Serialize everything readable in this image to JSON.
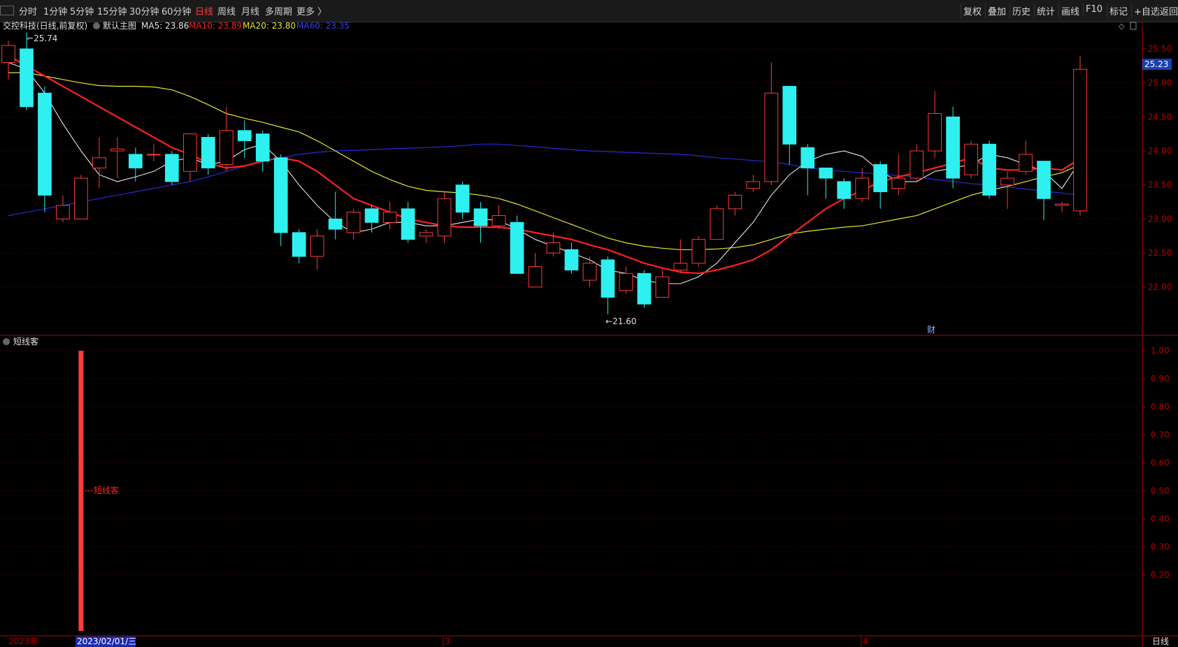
{
  "toolbar": {
    "periods": [
      "分时",
      "1分钟",
      "5分钟",
      "15分钟",
      "30分钟",
      "60分钟",
      "日线",
      "周线",
      "月线",
      "多周期",
      "更多 〉"
    ],
    "active_period": "日线",
    "right_buttons": [
      "复权",
      "叠加",
      "历史",
      "统计",
      "画线",
      "F10",
      "标记",
      "+自选",
      "返回"
    ]
  },
  "header": {
    "stock": "交控科技(日线,前复权)",
    "main_chart": "默认主图",
    "ma5": "MA5: 23.86",
    "ma10": "MA10: 23.89",
    "ma20": "MA20: 23.80",
    "ma60": "MA60: 23.35"
  },
  "colors": {
    "up": "#ff3b3b",
    "down": "#2ef0f0",
    "ma5": "#e8e8e8",
    "ma10": "#ff2020",
    "ma20": "#e6e62e",
    "ma60": "#2a2ad8",
    "axis": "#b40000"
  },
  "annotations": {
    "high": "25.74",
    "low": "21.60",
    "fin": "财"
  },
  "last_price": "25.23",
  "indicator": {
    "name": "短线客",
    "label": "短线客"
  },
  "xaxis": {
    "year": "2023年",
    "cursor_date": "2023/02/01/三",
    "m3": "3",
    "m4": "4",
    "period": "日线"
  },
  "chart_data": {
    "type": "candlestick",
    "price_axis": {
      "ticks": [
        "25.50",
        "25.00",
        "24.50",
        "24.00",
        "23.50",
        "23.00",
        "22.50",
        "22.00"
      ],
      "ylim": [
        21.3,
        25.9
      ]
    },
    "candles": [
      [
        25.3,
        25.55,
        25.62,
        25.05
      ],
      [
        25.5,
        24.65,
        25.74,
        24.6
      ],
      [
        24.85,
        23.35,
        24.95,
        23.1
      ],
      [
        23.0,
        23.2,
        23.35,
        22.95
      ],
      [
        23.0,
        23.6,
        23.65,
        23.0
      ],
      [
        23.75,
        23.9,
        24.2,
        23.45
      ],
      [
        24.0,
        24.03,
        24.2,
        23.6
      ],
      [
        23.95,
        23.75,
        24.05,
        23.55
      ],
      [
        23.95,
        23.95,
        24.1,
        23.85
      ],
      [
        23.95,
        23.55,
        24.0,
        23.5
      ],
      [
        23.7,
        24.25,
        24.25,
        23.55
      ],
      [
        24.2,
        23.75,
        24.25,
        23.65
      ],
      [
        23.8,
        24.3,
        24.65,
        23.7
      ],
      [
        24.3,
        24.15,
        24.45,
        23.9
      ],
      [
        24.25,
        23.85,
        24.3,
        23.7
      ],
      [
        23.9,
        22.8,
        23.95,
        22.6
      ],
      [
        22.8,
        22.45,
        22.85,
        22.35
      ],
      [
        22.45,
        22.75,
        22.85,
        22.25
      ],
      [
        23.0,
        22.85,
        23.4,
        22.7
      ],
      [
        22.8,
        23.1,
        23.15,
        22.7
      ],
      [
        23.15,
        22.95,
        23.2,
        22.8
      ],
      [
        22.95,
        23.1,
        23.25,
        22.85
      ],
      [
        23.15,
        22.7,
        23.25,
        22.65
      ],
      [
        22.75,
        22.8,
        22.85,
        22.65
      ],
      [
        22.75,
        23.3,
        23.4,
        22.65
      ],
      [
        23.5,
        23.1,
        23.55,
        23.0
      ],
      [
        23.15,
        22.9,
        23.25,
        22.65
      ],
      [
        22.9,
        23.05,
        23.2,
        22.85
      ],
      [
        22.95,
        22.2,
        23.05,
        22.2
      ],
      [
        22.0,
        22.3,
        22.5,
        22.0
      ],
      [
        22.5,
        22.65,
        22.8,
        22.45
      ],
      [
        22.55,
        22.25,
        22.65,
        22.2
      ],
      [
        22.1,
        22.35,
        22.45,
        22.0
      ],
      [
        22.4,
        21.85,
        22.45,
        21.6
      ],
      [
        21.95,
        22.2,
        22.3,
        21.9
      ],
      [
        22.2,
        21.75,
        22.25,
        21.7
      ],
      [
        21.85,
        22.15,
        22.25,
        21.85
      ],
      [
        22.25,
        22.35,
        22.7,
        22.2
      ],
      [
        22.35,
        22.7,
        22.75,
        22.3
      ],
      [
        22.7,
        23.15,
        23.2,
        22.7
      ],
      [
        23.15,
        23.35,
        23.4,
        23.05
      ],
      [
        23.45,
        23.55,
        23.65,
        23.4
      ],
      [
        23.55,
        24.85,
        25.3,
        23.5
      ],
      [
        24.95,
        24.1,
        24.95,
        23.8
      ],
      [
        24.05,
        23.75,
        24.1,
        23.35
      ],
      [
        23.75,
        23.6,
        23.75,
        23.3
      ],
      [
        23.55,
        23.3,
        23.6,
        23.15
      ],
      [
        23.3,
        23.6,
        23.75,
        23.25
      ],
      [
        23.8,
        23.4,
        23.85,
        23.15
      ],
      [
        23.45,
        23.6,
        23.95,
        23.35
      ],
      [
        23.6,
        24.0,
        24.1,
        23.55
      ],
      [
        24.0,
        24.55,
        24.88,
        23.9
      ],
      [
        24.5,
        23.6,
        24.65,
        23.45
      ],
      [
        23.65,
        24.1,
        24.15,
        23.6
      ],
      [
        24.1,
        23.35,
        24.15,
        23.3
      ],
      [
        23.5,
        23.6,
        23.7,
        23.15
      ],
      [
        23.7,
        23.95,
        24.15,
        23.65
      ],
      [
        23.85,
        23.3,
        23.85,
        22.98
      ],
      [
        23.2,
        23.22,
        23.25,
        23.1
      ],
      [
        23.12,
        25.2,
        25.4,
        23.05
      ]
    ],
    "ma5": [
      25.3,
      25.2,
      24.85,
      24.4,
      24.0,
      23.65,
      23.55,
      23.62,
      23.7,
      23.85,
      23.9,
      23.8,
      23.85,
      24.02,
      24.1,
      23.85,
      23.5,
      23.2,
      22.95,
      22.8,
      22.85,
      22.95,
      22.95,
      22.9,
      22.9,
      22.95,
      23.0,
      22.98,
      22.85,
      22.7,
      22.6,
      22.5,
      22.4,
      22.25,
      22.2,
      22.1,
      22.05,
      22.05,
      22.15,
      22.35,
      22.65,
      22.95,
      23.35,
      23.65,
      23.85,
      23.95,
      24.0,
      23.92,
      23.7,
      23.55,
      23.55,
      23.7,
      23.75,
      23.8,
      23.95,
      23.9,
      23.8,
      23.7,
      23.45,
      23.85
    ],
    "ma10": [
      25.4,
      25.25,
      25.1,
      24.95,
      24.8,
      24.65,
      24.5,
      24.35,
      24.2,
      24.05,
      23.95,
      23.82,
      23.75,
      23.78,
      23.85,
      23.9,
      23.85,
      23.7,
      23.5,
      23.3,
      23.2,
      23.1,
      23.0,
      22.95,
      22.9,
      22.88,
      22.88,
      22.88,
      22.85,
      22.8,
      22.75,
      22.7,
      22.62,
      22.55,
      22.45,
      22.35,
      22.28,
      22.22,
      22.2,
      22.25,
      22.32,
      22.4,
      22.55,
      22.75,
      22.95,
      23.15,
      23.3,
      23.42,
      23.55,
      23.62,
      23.68,
      23.75,
      23.82,
      23.9,
      23.75,
      23.72,
      23.72,
      23.75,
      23.72,
      23.89
    ],
    "ma20": [
      25.15,
      25.15,
      25.1,
      25.05,
      25.0,
      24.96,
      24.95,
      24.95,
      24.94,
      24.9,
      24.8,
      24.68,
      24.55,
      24.48,
      24.42,
      24.35,
      24.28,
      24.15,
      24.0,
      23.85,
      23.7,
      23.58,
      23.48,
      23.42,
      23.4,
      23.38,
      23.35,
      23.3,
      23.22,
      23.12,
      23.02,
      22.92,
      22.82,
      22.72,
      22.65,
      22.6,
      22.57,
      22.55,
      22.55,
      22.56,
      22.58,
      22.62,
      22.7,
      22.78,
      22.82,
      22.85,
      22.88,
      22.9,
      22.95,
      23.0,
      23.05,
      23.15,
      23.25,
      23.35,
      23.42,
      23.48,
      23.55,
      23.62,
      23.68,
      23.8
    ],
    "ma60": [
      23.05,
      23.1,
      23.15,
      23.2,
      23.25,
      23.3,
      23.35,
      23.4,
      23.45,
      23.5,
      23.55,
      23.62,
      23.7,
      23.78,
      23.85,
      23.9,
      23.95,
      23.98,
      24.0,
      24.01,
      24.02,
      24.03,
      24.04,
      24.05,
      24.06,
      24.08,
      24.1,
      24.1,
      24.08,
      24.06,
      24.04,
      24.02,
      24.0,
      23.99,
      23.98,
      23.97,
      23.96,
      23.95,
      23.93,
      23.9,
      23.88,
      23.86,
      23.84,
      23.8,
      23.75,
      23.72,
      23.7,
      23.68,
      23.66,
      23.64,
      23.62,
      23.58,
      23.55,
      23.52,
      23.5,
      23.47,
      23.44,
      23.41,
      23.38,
      23.35
    ],
    "indicator_axis": {
      "ticks": [
        "1.00",
        "0.90",
        "0.80",
        "0.70",
        "0.60",
        "0.50",
        "0.40",
        "0.30",
        "0.20"
      ],
      "ylim": [
        0.0,
        1.0
      ]
    },
    "indicator_signal": {
      "index": 4,
      "value": 1.0
    }
  }
}
